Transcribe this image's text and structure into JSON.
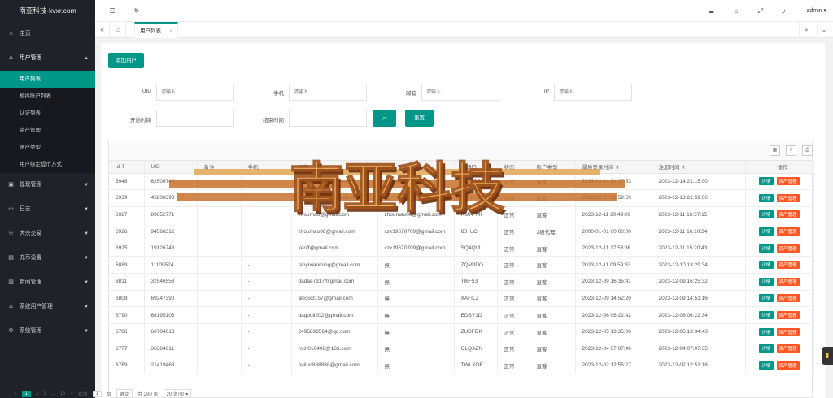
{
  "app": {
    "title": "南亚科技-kvxr.com"
  },
  "sidebar": {
    "items": [
      {
        "icon": "home-icon",
        "label": "主页",
        "glyph": "⌂",
        "arrow": ""
      },
      {
        "icon": "user-icon",
        "label": "用户管理",
        "glyph": "♙",
        "arrow": "▲"
      },
      {
        "icon": "withdraw-icon",
        "label": "提现管理",
        "glyph": "▣",
        "arrow": "▼"
      },
      {
        "icon": "log-icon",
        "label": "日志",
        "glyph": "▭",
        "arrow": "▼"
      },
      {
        "icon": "trade-icon",
        "label": "大宗交易",
        "glyph": "⚇",
        "arrow": "▼"
      },
      {
        "icon": "recharge-icon",
        "label": "充币设置",
        "glyph": "▤",
        "arrow": "▼"
      },
      {
        "icon": "news-icon",
        "label": "新闻管理",
        "glyph": "▥",
        "arrow": "▼"
      },
      {
        "icon": "admin-user-icon",
        "label": "系统用户管理",
        "glyph": "♙",
        "arrow": "▼"
      },
      {
        "icon": "settings-icon",
        "label": "系统管理",
        "glyph": "⚙",
        "arrow": "▼"
      }
    ],
    "sub_items": [
      "用户列表",
      "模拟账户列表",
      "认证列表",
      "资产管理",
      "账户类型",
      "用户绑定提币方式"
    ]
  },
  "topbar": {
    "user": "admin ▾"
  },
  "tabs": {
    "current": "用户列表",
    "close": "×"
  },
  "toolbar": {
    "add_user": "添加用户",
    "search": "⌕",
    "reset": "重置"
  },
  "filters": {
    "uid_label": "UID",
    "uid_placeholder": "请输入",
    "phone_label": "手机",
    "phone_placeholder": "请输入",
    "email_label": "邮箱",
    "email_placeholder": "请输入",
    "ip_label": "IP",
    "ip_placeholder": "请输入",
    "start_label": "开始时间",
    "end_label": "结束时间"
  },
  "table": {
    "headers": [
      "id ⇕",
      "UID",
      "备注",
      "手机",
      "邮箱",
      "上级",
      "邀请码",
      "状态",
      "账户类型",
      "最后登录时间 ⇕",
      "注册时间 ⇕",
      "操作"
    ],
    "rows": [
      [
        "6948",
        "62506744",
        "",
        "",
        "jiamasu@outlook.com",
        "311081@163.com",
        "KEJ9RP",
        "正常",
        "直客",
        "2023-12-14 21:27:53",
        "2023-12-14 21:15:00"
      ],
      [
        "6939",
        "45808393",
        "",
        "",
        "ou.qiang0206@gmail.com",
        "無",
        "OPS2GR",
        "正常",
        "直客",
        "2023-12-13 21:59:50",
        "2023-12-13 21:59:06"
      ],
      [
        "6927",
        "89652771",
        "",
        "",
        "zhoumao@gmail.com",
        "zhoumao08@gmail.com",
        "RMAFMI",
        "正常",
        "直客",
        "2023-12-11 20:49:09",
        "2023-12-11 16:37:15"
      ],
      [
        "6926",
        "94568312",
        "",
        "",
        "zhoumao08@gmail.com",
        "czx19670709@gmail.com",
        "IEHUCI",
        "正常",
        "2级代理",
        "2000-01-01 00:00:00",
        "2023-12-11 16:10:34"
      ],
      [
        "6925",
        "19126743",
        "",
        "",
        "kenff@gmail.com",
        "czx19670709@gmail.com",
        "SQ4QVU",
        "正常",
        "直客",
        "2023-12-11 17:58:36",
        "2023-12-11 15:20:43"
      ],
      [
        "6889",
        "11109524",
        "",
        "-",
        "fanyixiaoming@gmail.com",
        "無",
        "ZQMJDO",
        "正常",
        "直客",
        "2023-12-11 09:59:53",
        "2023-12-10 13:29:34"
      ],
      [
        "6811",
        "32546558",
        "",
        "-",
        "dadae7317@gmail.com",
        "無",
        "TI6F53",
        "正常",
        "直客",
        "2023-12-09 16:35:41",
        "2023-12-09 16:25:32"
      ],
      [
        "6808",
        "69247390",
        "",
        "-",
        "alesix3157@gmail.com",
        "無",
        "XAFILJ",
        "正常",
        "直客",
        "2023-12-09 14:52:20",
        "2023-12-09 14:51:16"
      ],
      [
        "6790",
        "68195103",
        "",
        "-",
        "dagouli202@gmail.com",
        "無",
        "EDBY1D",
        "正常",
        "直客",
        "2023-12-06 06:22:42",
        "2023-12-06 06:22:34"
      ],
      [
        "6786",
        "60704013",
        "",
        "-",
        "2495893564@qq.com",
        "無",
        "ZUDFDK",
        "正常",
        "直客",
        "2023-12-05 13:35:06",
        "2023-12-05 13:34:43"
      ],
      [
        "6777",
        "36384611",
        "",
        "-",
        "mlin010408@163.com",
        "無",
        "OLQAZN",
        "正常",
        "直客",
        "2023-12-04 07:07:46",
        "2023-12-04 07:07:35"
      ],
      [
        "6769",
        "21419468",
        "",
        "-",
        "hailun888888@gmail.com",
        "無",
        "TWLXOE",
        "正常",
        "直客",
        "2023-12-02 12:55:27",
        "2023-12-02 12:51:18"
      ]
    ],
    "btn_detail": "详情",
    "btn_asset": "资产管理"
  },
  "pager": {
    "prev": "<",
    "pages": [
      "1",
      "2",
      "3",
      "...",
      "15"
    ],
    "next": ">",
    "goto": "到第",
    "page_value": "1",
    "page_unit": "页",
    "confirm": "确定",
    "total": "共 290 条",
    "per_page": "20 条/页 ▾"
  },
  "watermark": {
    "text": "南亚科技"
  },
  "colors": {
    "accent": "#009688",
    "danger": "#ff5722",
    "sidebar": "#20222a"
  }
}
